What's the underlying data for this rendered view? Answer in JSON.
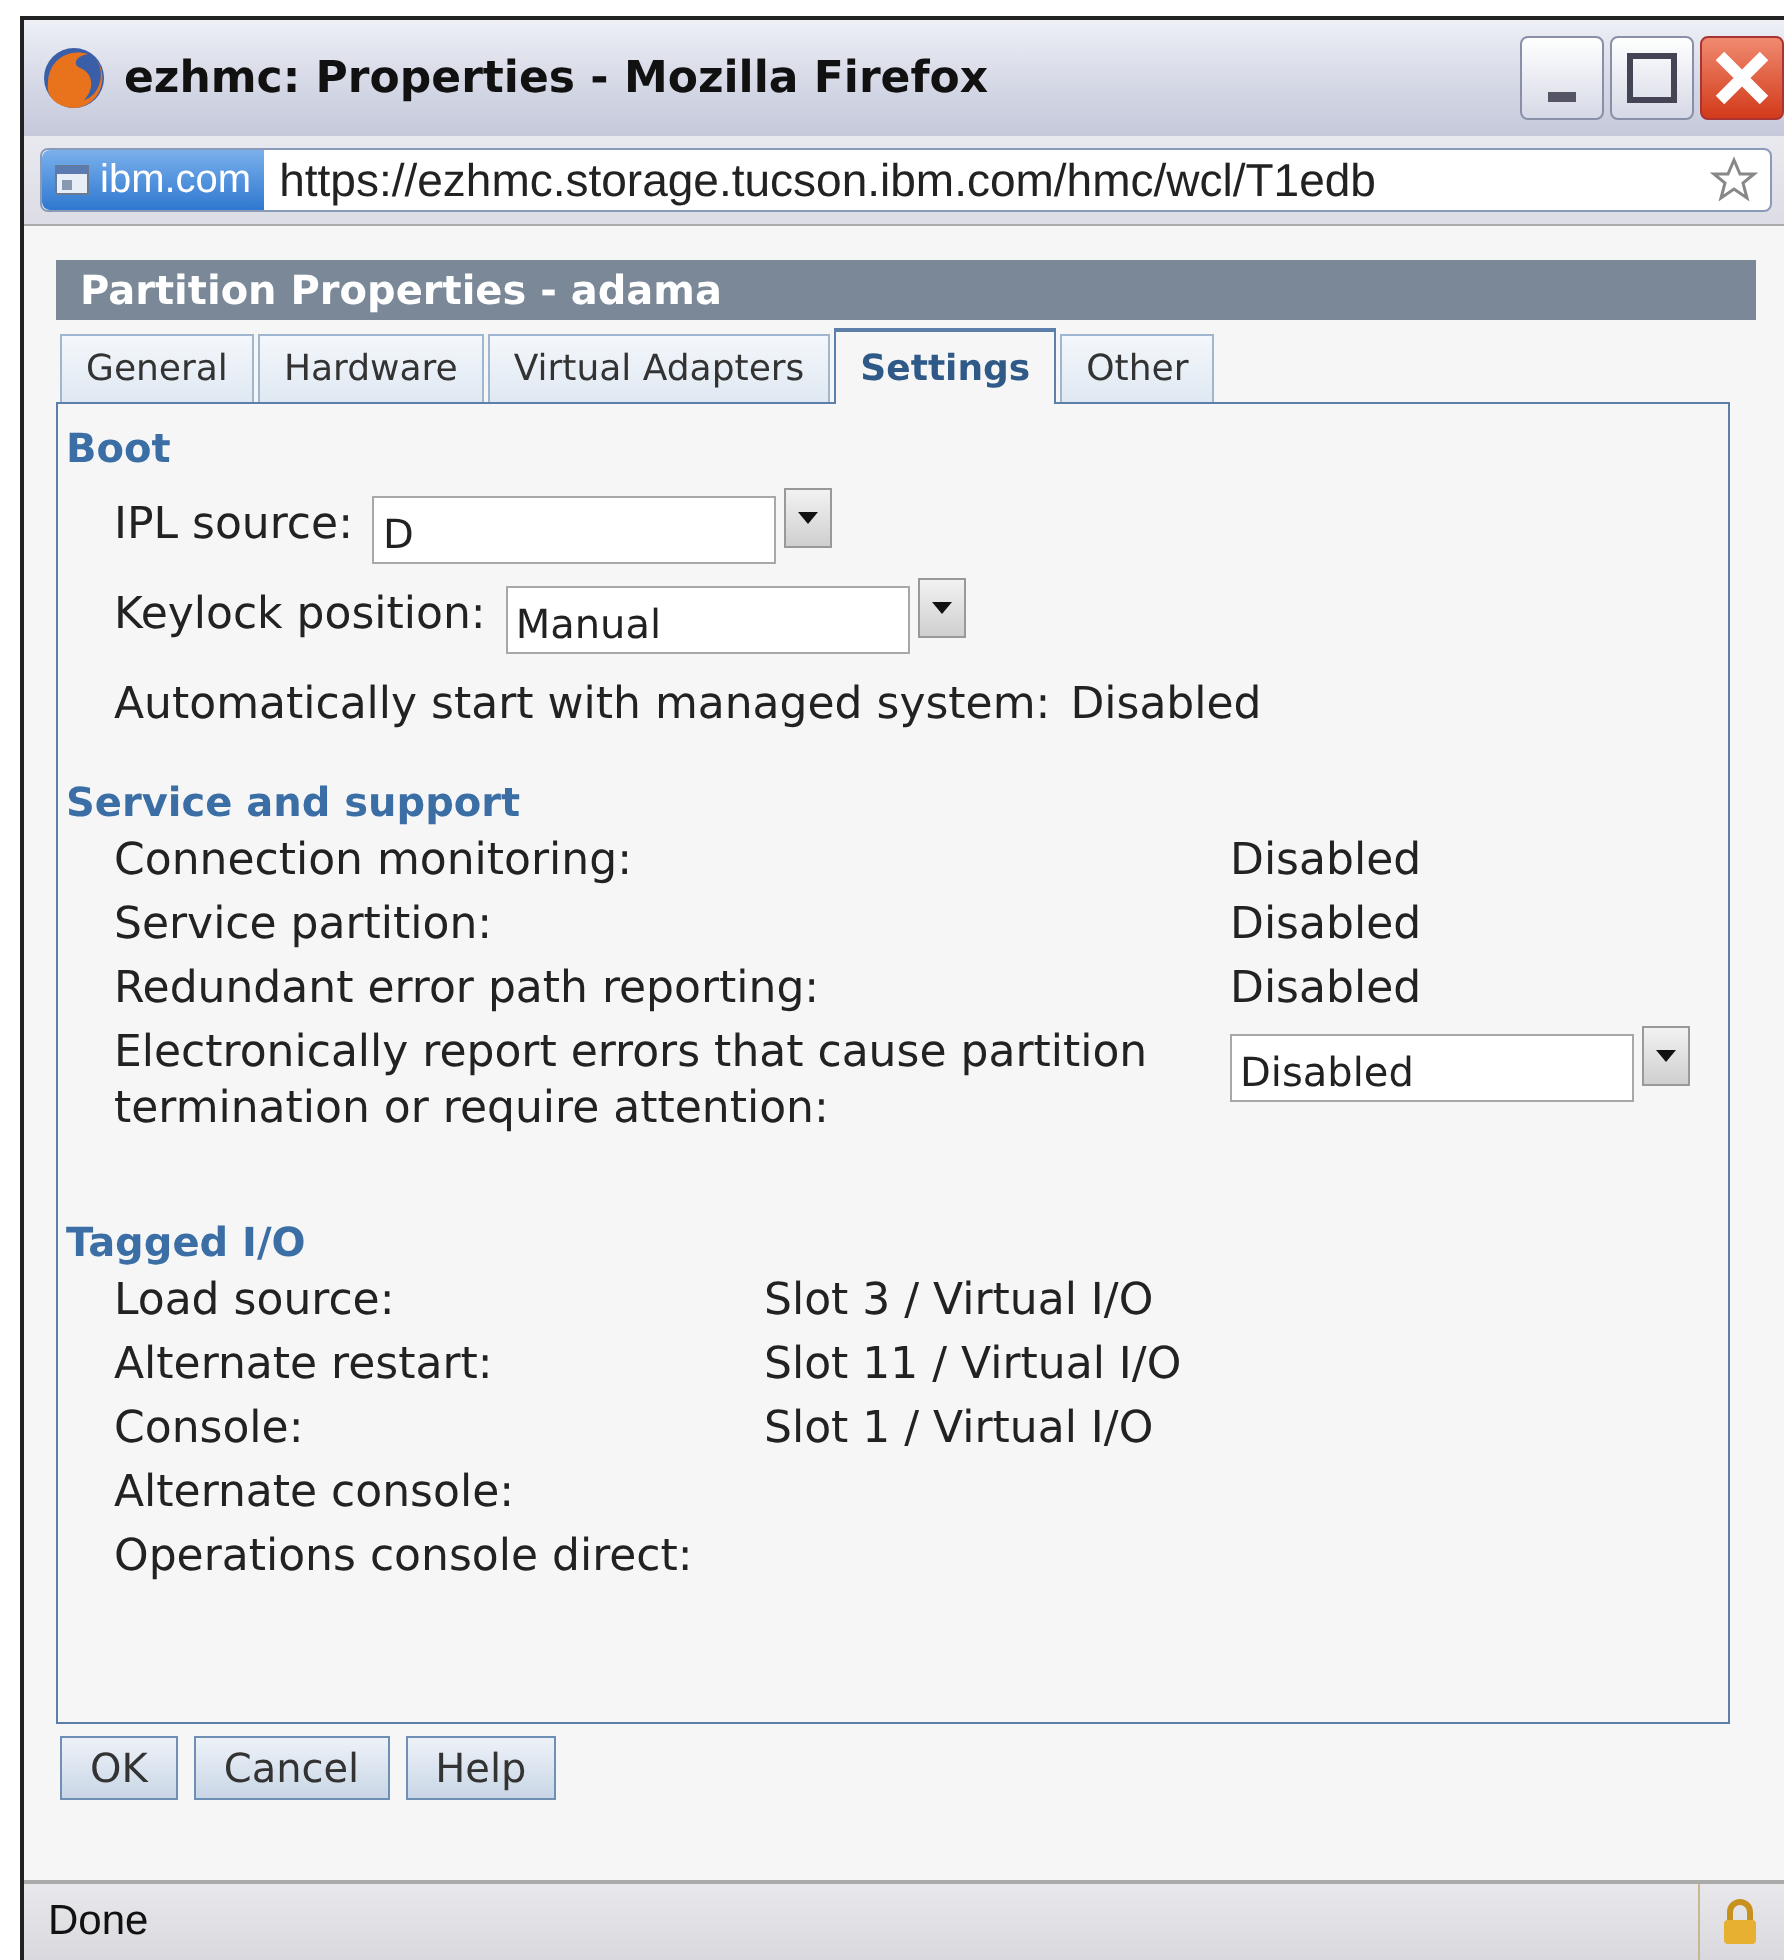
{
  "window": {
    "title": "ezhmc: Properties - Mozilla Firefox"
  },
  "address_bar": {
    "site": "ibm.com",
    "url": "https://ezhmc.storage.tucson.ibm.com/hmc/wcl/T1edb"
  },
  "panel": {
    "title": "Partition Properties - adama"
  },
  "tabs": [
    {
      "label": "General",
      "selected": false
    },
    {
      "label": "Hardware",
      "selected": false
    },
    {
      "label": "Virtual Adapters",
      "selected": false
    },
    {
      "label": "Settings",
      "selected": true
    },
    {
      "label": "Other",
      "selected": false
    }
  ],
  "sections": [
    {
      "heading": "Boot",
      "kind": "inline",
      "rows": [
        {
          "kind": "select",
          "label": "IPL source:",
          "value": "D"
        },
        {
          "kind": "select",
          "label": "Keylock position:",
          "value": "Manual"
        },
        {
          "kind": "text",
          "label": "Automatically start with managed system:",
          "value": "Disabled"
        }
      ]
    },
    {
      "heading": "Service and support",
      "kind": "wide",
      "rows": [
        {
          "kind": "text",
          "label": "Connection monitoring:",
          "value": "Disabled"
        },
        {
          "kind": "text",
          "label": "Service partition:",
          "value": "Disabled"
        },
        {
          "kind": "text",
          "label": "Redundant error path reporting:",
          "value": "Disabled"
        },
        {
          "kind": "select",
          "label": "Electronically report errors that cause partition termination or require attention:",
          "value": "Disabled"
        }
      ]
    },
    {
      "heading": "Tagged I/O",
      "kind": "narrow",
      "rows": [
        {
          "kind": "text",
          "label": "Load source:",
          "value": "Slot 3 / Virtual I/O"
        },
        {
          "kind": "text",
          "label": "Alternate restart:",
          "value": "Slot 11 / Virtual I/O"
        },
        {
          "kind": "text",
          "label": "Console:",
          "value": "Slot 1 / Virtual I/O"
        },
        {
          "kind": "text",
          "label": "Alternate console:"
        },
        {
          "kind": "text",
          "label": "Operations console direct:"
        }
      ]
    }
  ],
  "buttons": [
    "OK",
    "Cancel",
    "Help"
  ],
  "status_bar": {
    "text": "Done"
  }
}
